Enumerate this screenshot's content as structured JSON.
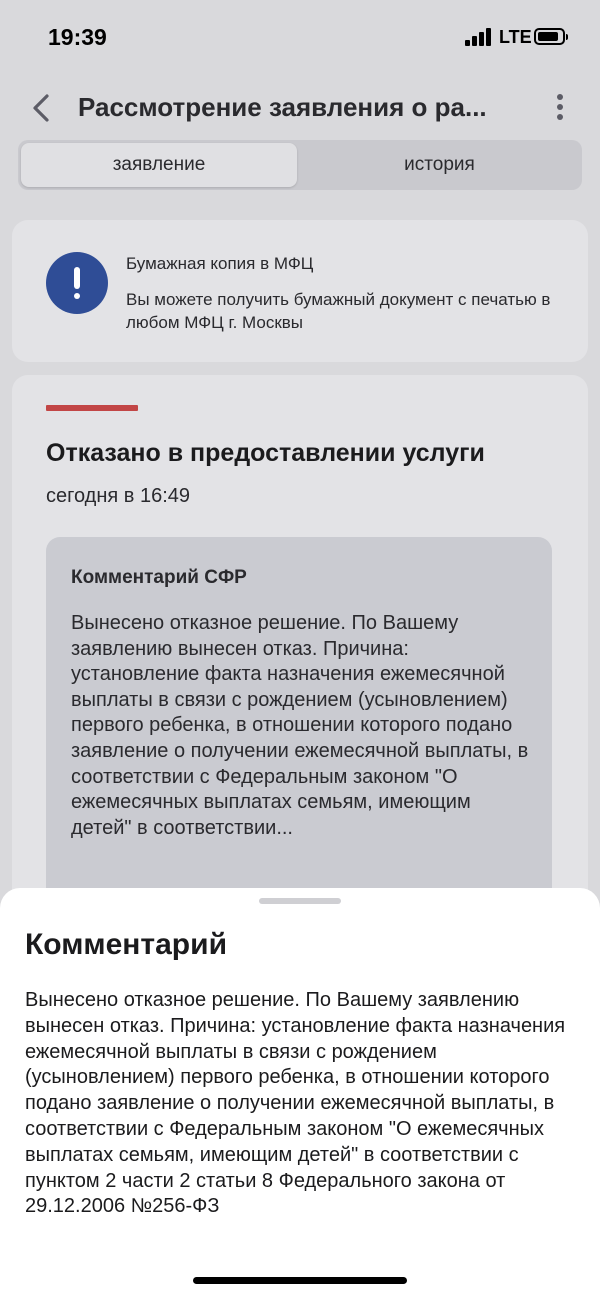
{
  "status_bar": {
    "time": "19:39",
    "network": "LTE",
    "icons": [
      "signal-icon",
      "battery-icon"
    ]
  },
  "header": {
    "back_icon": "chevron-left-icon",
    "title": "Рассмотрение заявления о ра...",
    "more_icon": "more-vertical-icon"
  },
  "tabs": [
    {
      "label": "заявление",
      "active": true
    },
    {
      "label": "история",
      "active": false
    }
  ],
  "notice": {
    "icon": "exclamation-icon",
    "title": "Бумажная копия в МФЦ",
    "text": "Вы можете получить бумажный документ с печатью в любом МФЦ г. Москвы",
    "icon_color": "#2f4d96"
  },
  "status": {
    "accent_color": "#c24646",
    "title": "Отказано в предоставлении услуги",
    "date": "сегодня в 16:49",
    "comment": {
      "title": "Комментарий СФР",
      "text": "Вынесено отказное решение. По Вашему заявлению вынесен отказ. Причина: установление факта назначения ежемесячной выплаты в связи с рождением (усыновлением) первого ребенка, в отношении которого подано заявление о получении ежемесячной выплаты, в соответствии с Федеральным законом \"О ежемесячных выплатах семьям, имеющим детей\" в соответствии..."
    }
  },
  "sheet": {
    "title": "Комментарий",
    "text": "Вынесено отказное решение. По Вашему заявлению вынесен отказ. Причина: установление факта назначения ежемесячной выплаты в связи с рождением (усыновлением) первого ребенка, в отношении которого подано заявление о получении ежемесячной выплаты, в соответствии с Федеральным законом \"О ежемесячных выплатах семьям, имеющим детей\" в соответствии с пунктом 2 части 2 статьи 8 Федерального закона от 29.12.2006 №256-ФЗ"
  }
}
